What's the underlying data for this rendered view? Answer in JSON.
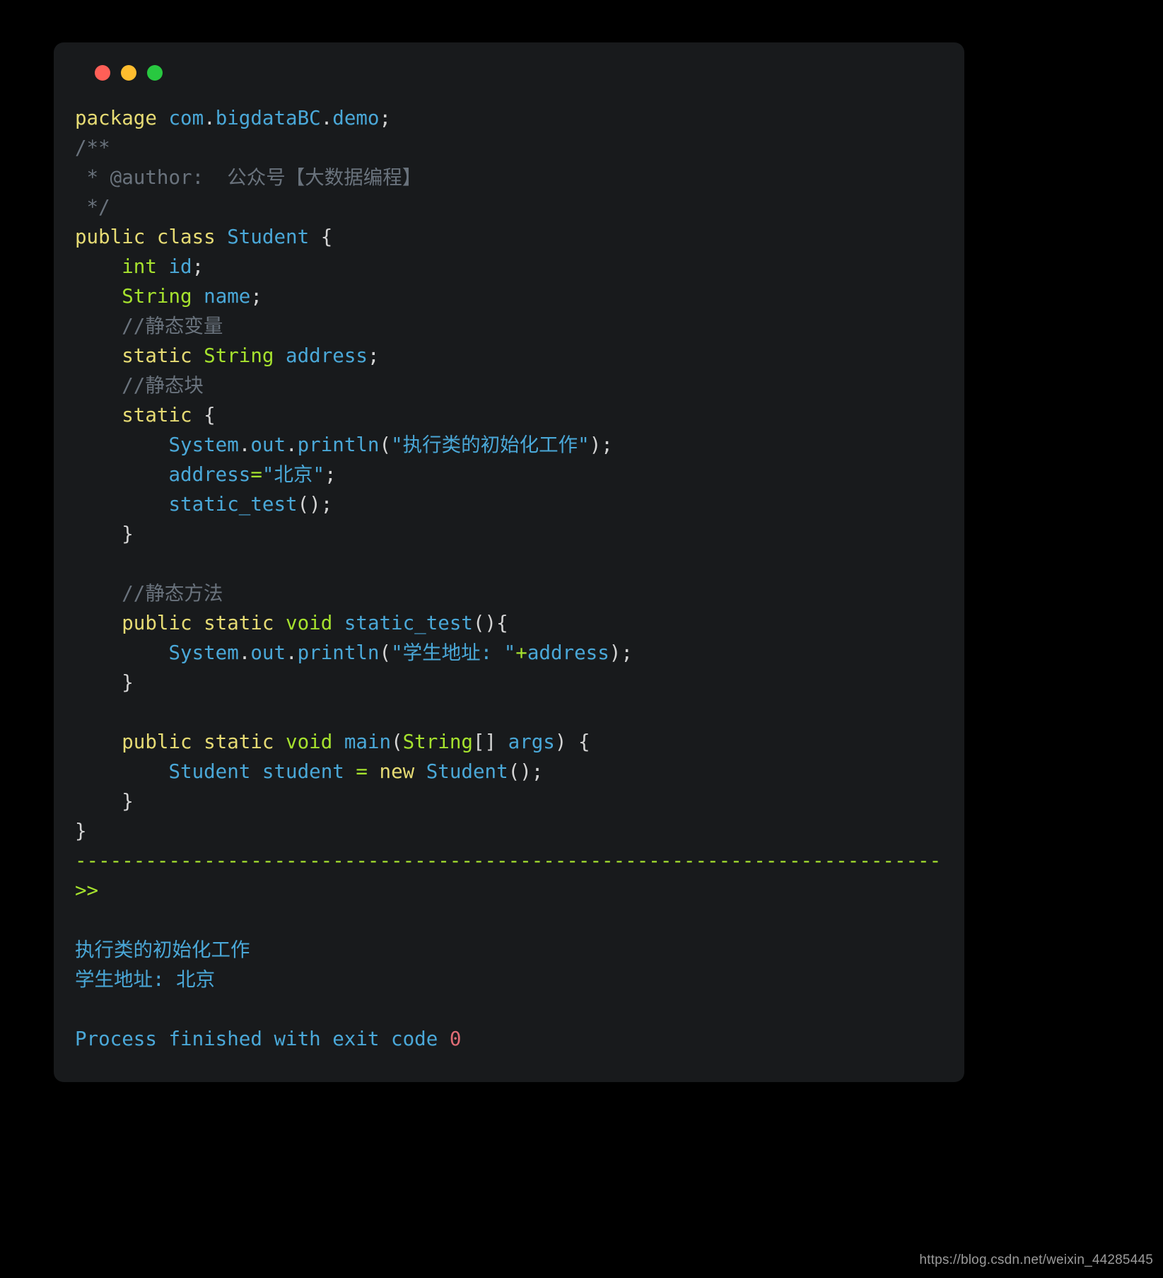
{
  "window": {
    "dots": [
      {
        "name": "close",
        "color": "#ff5f57"
      },
      {
        "name": "minimize",
        "color": "#ffbd2e"
      },
      {
        "name": "maximize",
        "color": "#28c840"
      }
    ]
  },
  "theme": {
    "page_background": "#000000",
    "card_background": "#181a1c",
    "keyword_color": "#e6db74",
    "type_color": "#a6e22e",
    "identifier_color": "#4aa8d8",
    "comment_color": "#6a737d",
    "punctuation_color": "#d4d4d4",
    "operator_color": "#a6e22e",
    "string_color": "#4aa8d8",
    "number_color": "#e06c75",
    "output_color": "#4aa8d8",
    "prompt_color": "#a6e22e"
  },
  "code": {
    "language": "java",
    "lines": [
      {
        "id": "l01",
        "tokens": [
          {
            "t": "package ",
            "c": "kw"
          },
          {
            "t": "com",
            "c": "ident"
          },
          {
            "t": ".",
            "c": "punc"
          },
          {
            "t": "bigdataBC",
            "c": "ident"
          },
          {
            "t": ".",
            "c": "punc"
          },
          {
            "t": "demo",
            "c": "ident"
          },
          {
            "t": ";",
            "c": "punc"
          }
        ]
      },
      {
        "id": "l02",
        "tokens": [
          {
            "t": "/**",
            "c": "cmt"
          }
        ]
      },
      {
        "id": "l03",
        "tokens": [
          {
            "t": " * @author:  公众号【大数据编程】",
            "c": "cmt"
          }
        ]
      },
      {
        "id": "l04",
        "tokens": [
          {
            "t": " */",
            "c": "cmt"
          }
        ]
      },
      {
        "id": "l05",
        "tokens": [
          {
            "t": "public class ",
            "c": "kw"
          },
          {
            "t": "Student",
            "c": "ident"
          },
          {
            "t": " {",
            "c": "punc"
          }
        ]
      },
      {
        "id": "l06",
        "tokens": [
          {
            "t": "    ",
            "c": "punc"
          },
          {
            "t": "int",
            "c": "type"
          },
          {
            "t": " ",
            "c": "punc"
          },
          {
            "t": "id",
            "c": "ident"
          },
          {
            "t": ";",
            "c": "punc"
          }
        ]
      },
      {
        "id": "l07",
        "tokens": [
          {
            "t": "    ",
            "c": "punc"
          },
          {
            "t": "String",
            "c": "type"
          },
          {
            "t": " ",
            "c": "punc"
          },
          {
            "t": "name",
            "c": "ident"
          },
          {
            "t": ";",
            "c": "punc"
          }
        ]
      },
      {
        "id": "l08",
        "tokens": [
          {
            "t": "    //静态变量",
            "c": "cmt"
          }
        ]
      },
      {
        "id": "l09",
        "tokens": [
          {
            "t": "    ",
            "c": "punc"
          },
          {
            "t": "static ",
            "c": "kw"
          },
          {
            "t": "String",
            "c": "type"
          },
          {
            "t": " ",
            "c": "punc"
          },
          {
            "t": "address",
            "c": "ident"
          },
          {
            "t": ";",
            "c": "punc"
          }
        ]
      },
      {
        "id": "l10",
        "tokens": [
          {
            "t": "    //静态块",
            "c": "cmt"
          }
        ]
      },
      {
        "id": "l11",
        "tokens": [
          {
            "t": "    ",
            "c": "punc"
          },
          {
            "t": "static",
            "c": "kw"
          },
          {
            "t": " {",
            "c": "punc"
          }
        ]
      },
      {
        "id": "l12",
        "tokens": [
          {
            "t": "        ",
            "c": "punc"
          },
          {
            "t": "System",
            "c": "ident"
          },
          {
            "t": ".",
            "c": "punc"
          },
          {
            "t": "out",
            "c": "ident"
          },
          {
            "t": ".",
            "c": "punc"
          },
          {
            "t": "println",
            "c": "ident"
          },
          {
            "t": "(",
            "c": "punc"
          },
          {
            "t": "\"执行类的初始化工作\"",
            "c": "str"
          },
          {
            "t": ");",
            "c": "punc"
          }
        ]
      },
      {
        "id": "l13",
        "tokens": [
          {
            "t": "        ",
            "c": "punc"
          },
          {
            "t": "address",
            "c": "ident"
          },
          {
            "t": "=",
            "c": "op"
          },
          {
            "t": "\"北京\"",
            "c": "str"
          },
          {
            "t": ";",
            "c": "punc"
          }
        ]
      },
      {
        "id": "l14",
        "tokens": [
          {
            "t": "        ",
            "c": "punc"
          },
          {
            "t": "static_test",
            "c": "ident"
          },
          {
            "t": "();",
            "c": "punc"
          }
        ]
      },
      {
        "id": "l15",
        "tokens": [
          {
            "t": "    }",
            "c": "punc"
          }
        ]
      },
      {
        "id": "l16",
        "tokens": [
          {
            "t": "",
            "c": "punc"
          }
        ]
      },
      {
        "id": "l17",
        "tokens": [
          {
            "t": "    //静态方法",
            "c": "cmt"
          }
        ]
      },
      {
        "id": "l18",
        "tokens": [
          {
            "t": "    ",
            "c": "punc"
          },
          {
            "t": "public static ",
            "c": "kw"
          },
          {
            "t": "void",
            "c": "type"
          },
          {
            "t": " ",
            "c": "punc"
          },
          {
            "t": "static_test",
            "c": "ident"
          },
          {
            "t": "(){",
            "c": "punc"
          }
        ]
      },
      {
        "id": "l19",
        "tokens": [
          {
            "t": "        ",
            "c": "punc"
          },
          {
            "t": "System",
            "c": "ident"
          },
          {
            "t": ".",
            "c": "punc"
          },
          {
            "t": "out",
            "c": "ident"
          },
          {
            "t": ".",
            "c": "punc"
          },
          {
            "t": "println",
            "c": "ident"
          },
          {
            "t": "(",
            "c": "punc"
          },
          {
            "t": "\"学生地址: \"",
            "c": "str"
          },
          {
            "t": "+",
            "c": "op"
          },
          {
            "t": "address",
            "c": "ident"
          },
          {
            "t": ");",
            "c": "punc"
          }
        ]
      },
      {
        "id": "l20",
        "tokens": [
          {
            "t": "    }",
            "c": "punc"
          }
        ]
      },
      {
        "id": "l21",
        "tokens": [
          {
            "t": "",
            "c": "punc"
          }
        ]
      },
      {
        "id": "l22",
        "tokens": [
          {
            "t": "    ",
            "c": "punc"
          },
          {
            "t": "public static ",
            "c": "kw"
          },
          {
            "t": "void",
            "c": "type"
          },
          {
            "t": " ",
            "c": "punc"
          },
          {
            "t": "main",
            "c": "ident"
          },
          {
            "t": "(",
            "c": "punc"
          },
          {
            "t": "String",
            "c": "type"
          },
          {
            "t": "[] ",
            "c": "punc"
          },
          {
            "t": "args",
            "c": "ident"
          },
          {
            "t": ") {",
            "c": "punc"
          }
        ]
      },
      {
        "id": "l23",
        "tokens": [
          {
            "t": "        ",
            "c": "punc"
          },
          {
            "t": "Student",
            "c": "ident"
          },
          {
            "t": " ",
            "c": "punc"
          },
          {
            "t": "student",
            "c": "ident"
          },
          {
            "t": " ",
            "c": "punc"
          },
          {
            "t": "=",
            "c": "op"
          },
          {
            "t": " ",
            "c": "punc"
          },
          {
            "t": "new ",
            "c": "kw"
          },
          {
            "t": "Student",
            "c": "ident"
          },
          {
            "t": "();",
            "c": "punc"
          }
        ]
      },
      {
        "id": "l24",
        "tokens": [
          {
            "t": "    }",
            "c": "punc"
          }
        ]
      },
      {
        "id": "l25",
        "tokens": [
          {
            "t": "}",
            "c": "punc"
          }
        ]
      }
    ]
  },
  "console": {
    "separator": "------------------------------------------------------------------------------------------",
    "prompt": ">>",
    "blank_after_prompt": "",
    "output_lines": [
      "执行类的初始化工作",
      "学生地址: 北京"
    ],
    "exit_message": "Process finished with exit code ",
    "exit_code": "0"
  },
  "watermark": {
    "text": "https://blog.csdn.net/weixin_44285445"
  }
}
